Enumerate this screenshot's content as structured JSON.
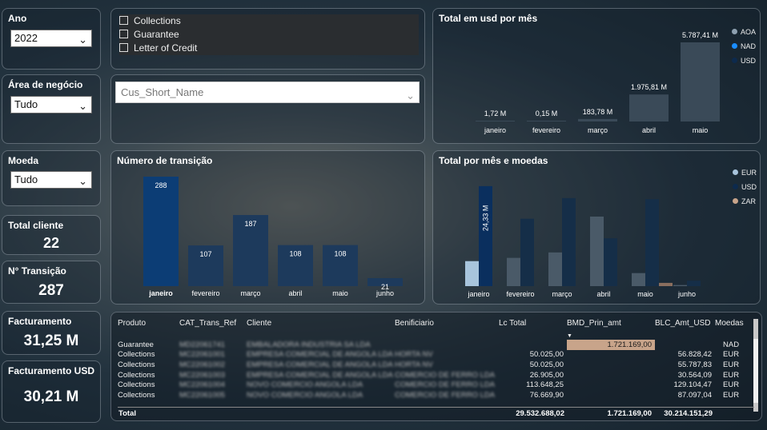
{
  "filters": {
    "ano": {
      "label": "Ano",
      "value": "2022"
    },
    "area": {
      "label": "Área de negócio",
      "value": "Tudo"
    },
    "moeda": {
      "label": "Moeda",
      "value": "Tudo"
    },
    "checklist": [
      "Collections",
      "Guarantee",
      "Letter of Credit"
    ],
    "customer_placeholder": "Cus_Short_Name"
  },
  "kpis": {
    "total_cliente": {
      "label": "Total cliente",
      "value": "22"
    },
    "n_transicao": {
      "label": "N° Transição",
      "value": "287"
    },
    "facturamento": {
      "label": "Facturamento",
      "value": "31,25 M"
    },
    "facturamento_usd": {
      "label": "Facturamento USD",
      "value": "30,21 M"
    }
  },
  "colors": {
    "aoa": "#8ea0b0",
    "nad": "#1a8cff",
    "usd": "#0d2a4d",
    "eur": "#a8c4dc",
    "zar": "#c8a48a",
    "bar_dark": "#0e3a6b"
  },
  "chart_data": [
    {
      "type": "bar",
      "title": "Total em usd  por mês",
      "legend": [
        "AOA",
        "NAD",
        "USD"
      ],
      "legend_position": "right",
      "categories": [
        "janeiro",
        "fevereiro",
        "março",
        "abril",
        "maio"
      ],
      "values": [
        1.72,
        0.15,
        183.78,
        1975.81,
        5787.41
      ],
      "value_labels": [
        "1,72 M",
        "0,15 M",
        "183,78 M",
        "1.975,81 M",
        "5.787,41 M"
      ],
      "ylim": [
        0,
        5787.41
      ]
    },
    {
      "type": "bar",
      "title": "Número de transição",
      "categories": [
        "janeiro",
        "fevereiro",
        "março",
        "abril",
        "maio",
        "junho"
      ],
      "values": [
        288,
        107,
        187,
        108,
        108,
        21
      ],
      "ylim": [
        0,
        288
      ]
    },
    {
      "type": "bar",
      "title": "Total por mês e moedas",
      "legend": [
        "EUR",
        "USD",
        "ZAR"
      ],
      "legend_position": "right",
      "categories": [
        "janeiro",
        "fevereiro",
        "março",
        "abril",
        "maio",
        "junho"
      ],
      "series": [
        {
          "name": "EUR",
          "values": [
            0.23,
            0.26,
            0.31,
            0.64,
            0.12,
            0.01
          ]
        },
        {
          "name": "USD",
          "values": [
            0.92,
            0.62,
            0.81,
            0.44,
            0.8,
            0.05
          ]
        },
        {
          "name": "ZAR",
          "values": [
            0,
            0,
            0,
            0,
            0.03,
            0
          ]
        }
      ],
      "data_labels": [
        "24,33 M"
      ],
      "ylim": [
        0,
        1
      ]
    }
  ],
  "table": {
    "headers": [
      "Produto",
      "CAT_Trans_Ref",
      "Cliente",
      "Benificiario",
      "Lc Total",
      "BMD_Prin_amt",
      "BLC_Amt_USD",
      "Moedas"
    ],
    "rows": [
      {
        "produto": "Guarantee",
        "ref": "MD22061741",
        "cliente": "EMBALADORA INDUSTRIA SA LDA",
        "benef": "",
        "lc": "",
        "bmd": "1.721.169,00",
        "blc": "",
        "moeda": "NAD"
      },
      {
        "produto": "Collections",
        "ref": "MC22061001",
        "cliente": "EMPRESA COMERCIAL DE ANGOLA LDA",
        "benef": "HORTA NV",
        "lc": "50.025,00",
        "bmd": "",
        "blc": "56.828,42",
        "moeda": "EUR"
      },
      {
        "produto": "Collections",
        "ref": "MC22061002",
        "cliente": "EMPRESA COMERCIAL DE ANGOLA LDA",
        "benef": "HORTA NV",
        "lc": "50.025,00",
        "bmd": "",
        "blc": "55.787,83",
        "moeda": "EUR"
      },
      {
        "produto": "Collections",
        "ref": "MC22061003",
        "cliente": "EMPRESA COMERCIAL DE ANGOLA LDA",
        "benef": "COMERCIO DE FERRO LDA",
        "lc": "26.905,00",
        "bmd": "",
        "blc": "30.564,09",
        "moeda": "EUR"
      },
      {
        "produto": "Collections",
        "ref": "MC22061004",
        "cliente": "NOVO COMERCIO ANGOLA LDA",
        "benef": "COMERCIO DE FERRO LDA",
        "lc": "113.648,25",
        "bmd": "",
        "blc": "129.104,47",
        "moeda": "EUR"
      },
      {
        "produto": "Collections",
        "ref": "MC22061005",
        "cliente": "NOVO COMERCIO ANGOLA LDA",
        "benef": "COMERCIO DE FERRO LDA",
        "lc": "76.669,90",
        "bmd": "",
        "blc": "87.097,04",
        "moeda": "EUR"
      }
    ],
    "total": {
      "label": "Total",
      "lc": "29.532.688,02",
      "bmd": "1.721.169,00",
      "blc": "30.214.151,29"
    }
  }
}
